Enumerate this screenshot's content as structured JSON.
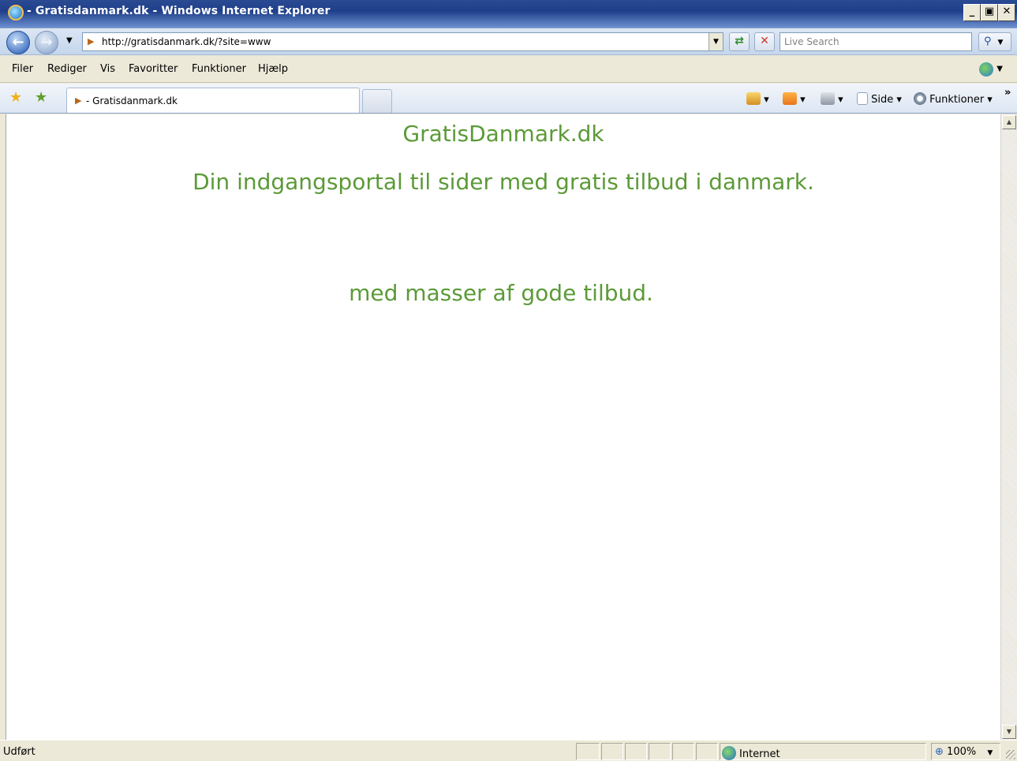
{
  "window": {
    "title": "- Gratisdanmark.dk - Windows Internet Explorer",
    "minimize": "_",
    "maximize": "▣",
    "close": "✕"
  },
  "address_bar": {
    "url": "http://gratisdanmark.dk/?site=www",
    "search_placeholder": "Live Search"
  },
  "menu": {
    "items": [
      "Filer",
      "Rediger",
      "Vis",
      "Favoritter",
      "Funktioner",
      "Hjælp"
    ]
  },
  "tab": {
    "label": "- Gratisdanmark.dk"
  },
  "command_bar": {
    "page_label": "Side",
    "tools_label": "Funktioner"
  },
  "page": {
    "title": "GratisDanmark.dk",
    "tagline": "Din indgangsportal til sider med gratis tilbud i danmark.",
    "offers": "med masser af gode tilbud."
  },
  "status": {
    "text": "Udført",
    "zone": "Internet",
    "zoom": "100%"
  },
  "colors": {
    "page_text": "#5b9a37",
    "titlebar": "#1f3f8a"
  }
}
